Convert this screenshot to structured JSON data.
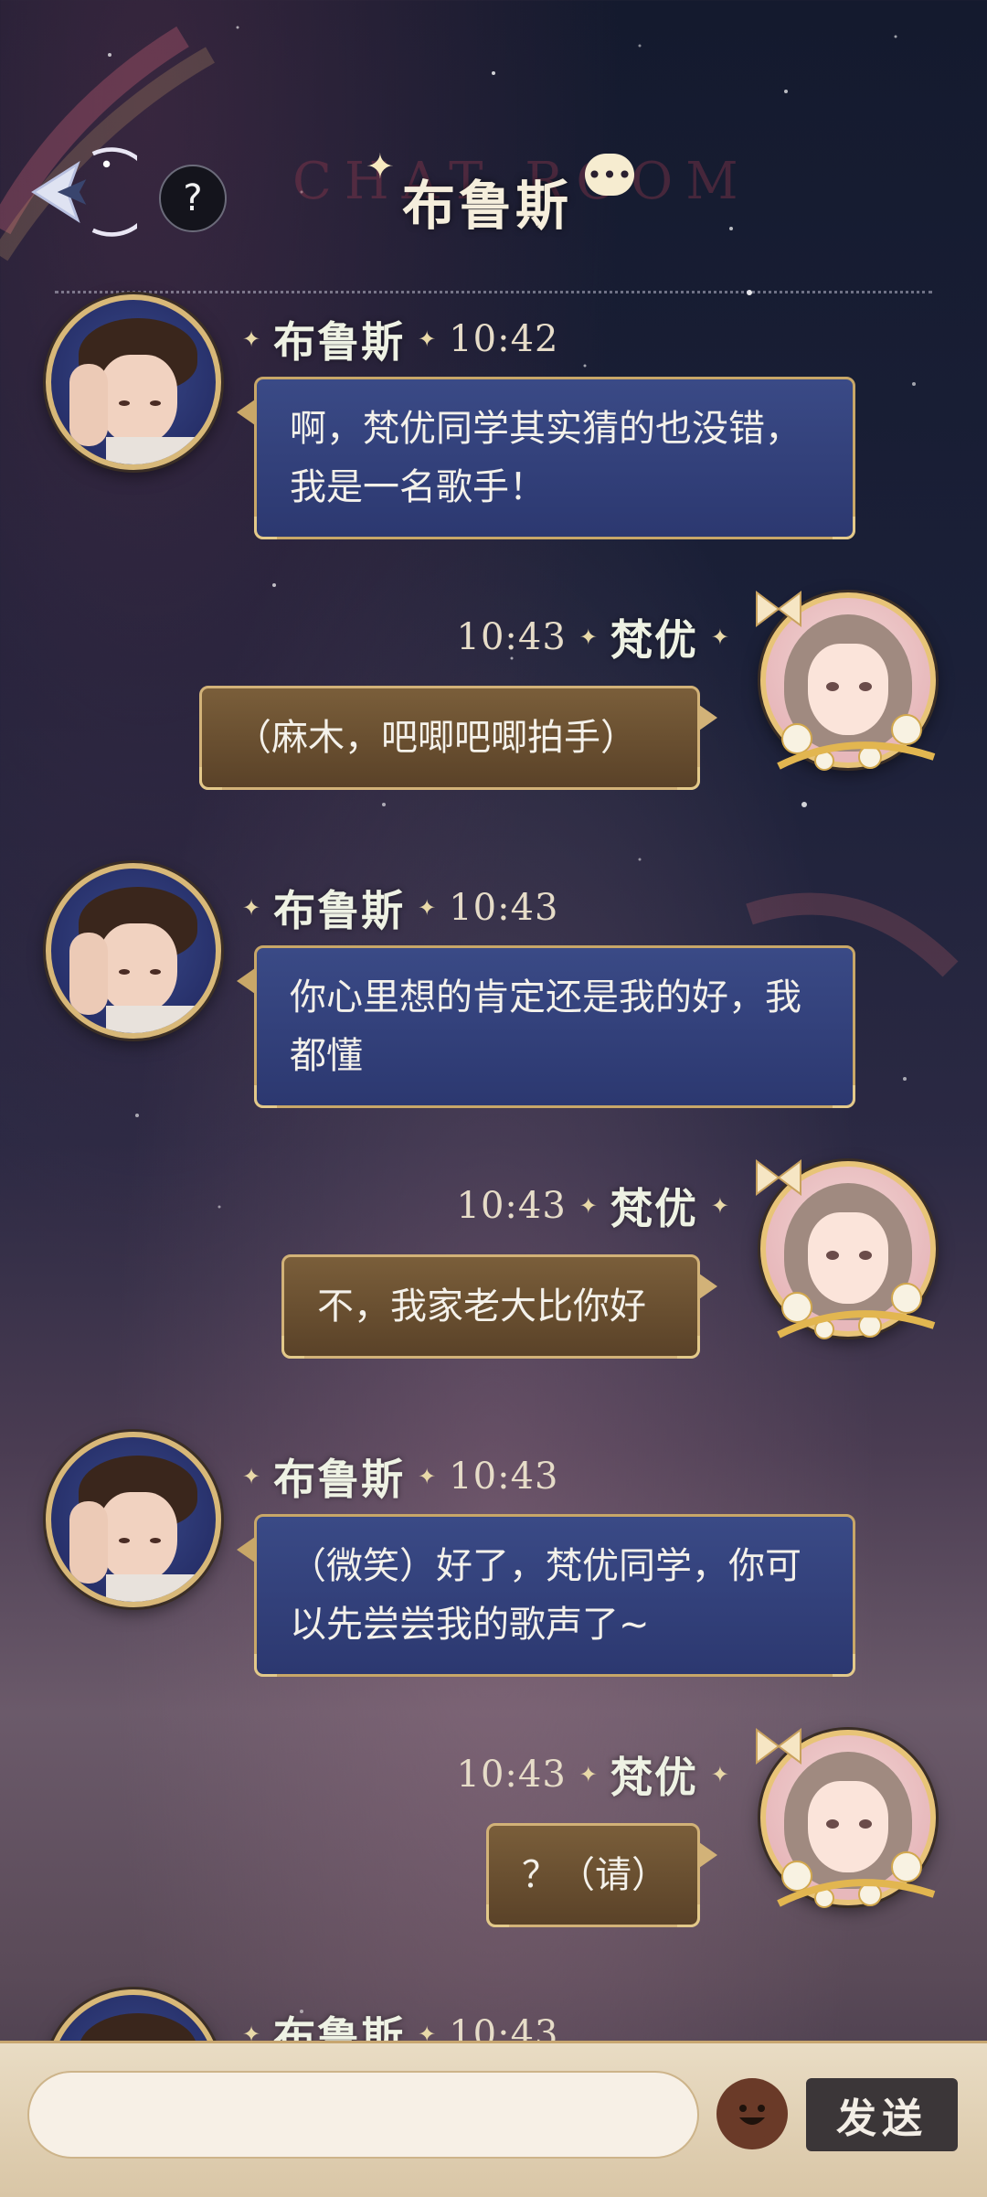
{
  "header": {
    "title": "布鲁斯",
    "watermark": "CHAT ROOM",
    "help_label": "?"
  },
  "messages": [
    {
      "side": "left",
      "sender": "布鲁斯",
      "time": "10:42",
      "text": "啊，梵优同学其实猜的也没错，我是一名歌手！"
    },
    {
      "side": "right",
      "sender": "梵优",
      "time": "10:43",
      "text": "（麻木，吧唧吧唧拍手）"
    },
    {
      "side": "left",
      "sender": "布鲁斯",
      "time": "10:43",
      "text": "你心里想的肯定还是我的好，我都懂"
    },
    {
      "side": "right",
      "sender": "梵优",
      "time": "10:43",
      "text": "不，我家老大比你好"
    },
    {
      "side": "left",
      "sender": "布鲁斯",
      "time": "10:43",
      "text": "（微笑）好了，梵优同学，你可以先尝尝我的歌声了~"
    },
    {
      "side": "right",
      "sender": "梵优",
      "time": "10:43",
      "text": "？（请）"
    },
    {
      "side": "left",
      "sender": "布鲁斯",
      "time": "10:43",
      "text": ""
    }
  ],
  "composer": {
    "input_value": "",
    "send_label": "发送"
  },
  "icons": {
    "back": "back-arrow-icon",
    "help": "question-mark-icon",
    "chat": "chat-bubble-icon",
    "emoji": "smiley-face-icon"
  },
  "colors": {
    "left_bubble": "#34427c",
    "right_bubble": "#6b5032",
    "bubble_border": "#c8a768",
    "send_button": "#3b3638"
  }
}
